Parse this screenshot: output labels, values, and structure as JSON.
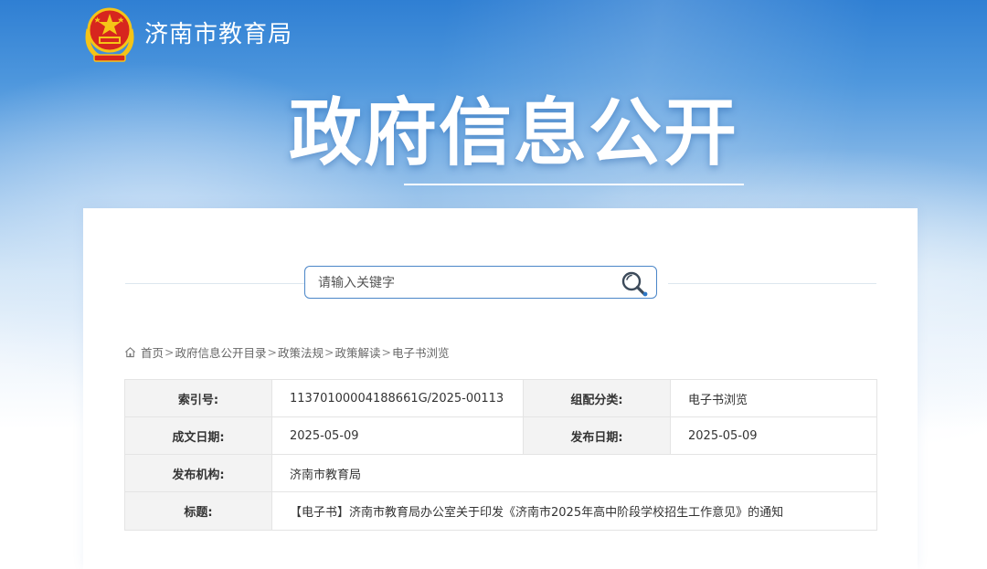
{
  "header": {
    "site_name": "济南市教育局",
    "logo_icon": "national-emblem-icon",
    "main_title": "政府信息公开"
  },
  "search": {
    "placeholder": "请输入关键字",
    "value": "",
    "icon": "search-icon"
  },
  "breadcrumb": {
    "home_icon": "home-icon",
    "items": [
      "首页",
      "政府信息公开目录",
      "政策法规",
      "政策解读",
      "电子书浏览"
    ],
    "separator": ">"
  },
  "info_table": {
    "index_label": "索引号:",
    "index_value": "11370100004188661G/2025-00113",
    "category_label": "组配分类:",
    "category_value": "电子书浏览",
    "written_date_label": "成文日期:",
    "written_date_value": "2025-05-09",
    "publish_date_label": "发布日期:",
    "publish_date_value": "2025-05-09",
    "issuer_label": "发布机构:",
    "issuer_value": "济南市教育局",
    "title_label": "标题:",
    "title_value": "【电子书】济南市教育局办公室关于印发《济南市2025年高中阶段学校招生工作意见》的通知"
  },
  "colors": {
    "banner_top": "#2f7fd3",
    "accent_border": "#4b86c8",
    "emblem_red": "#d7261e",
    "emblem_gold": "#f5c417",
    "label_bg": "#f3f3f3"
  }
}
